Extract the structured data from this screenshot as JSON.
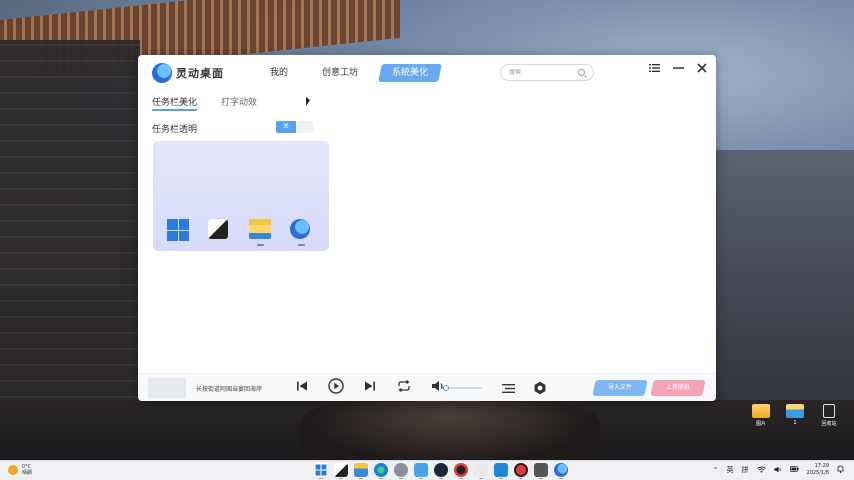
{
  "app": {
    "name": "灵动桌面",
    "nav": [
      {
        "label": "我的"
      },
      {
        "label": "创意工坊"
      },
      {
        "label": "系统美化"
      }
    ],
    "search_placeholder": "搜索"
  },
  "subtabs": [
    {
      "label": "任务栏美化"
    },
    {
      "label": "打字动效"
    }
  ],
  "option": {
    "label": "任务栏透明",
    "toggle_text": "关"
  },
  "player": {
    "song": "长按街道阿国当宴回海岸",
    "volume_percent": 10,
    "import_label": "导入文件",
    "upload_label": "上传壁纸"
  },
  "desktop_icons": [
    {
      "label": "图片"
    },
    {
      "label": "1"
    },
    {
      "label": "回收站"
    }
  ],
  "taskbar": {
    "weather_temp": "0°C",
    "weather_desc": "晴朗",
    "ime_lang": "英",
    "ime_mode": "拼",
    "time": "17:29",
    "date": "2025/1/8"
  },
  "colors": {
    "accent": "#6aa8ef",
    "upload": "#f3a5b5",
    "preview_bg": "#dfe1fa"
  }
}
